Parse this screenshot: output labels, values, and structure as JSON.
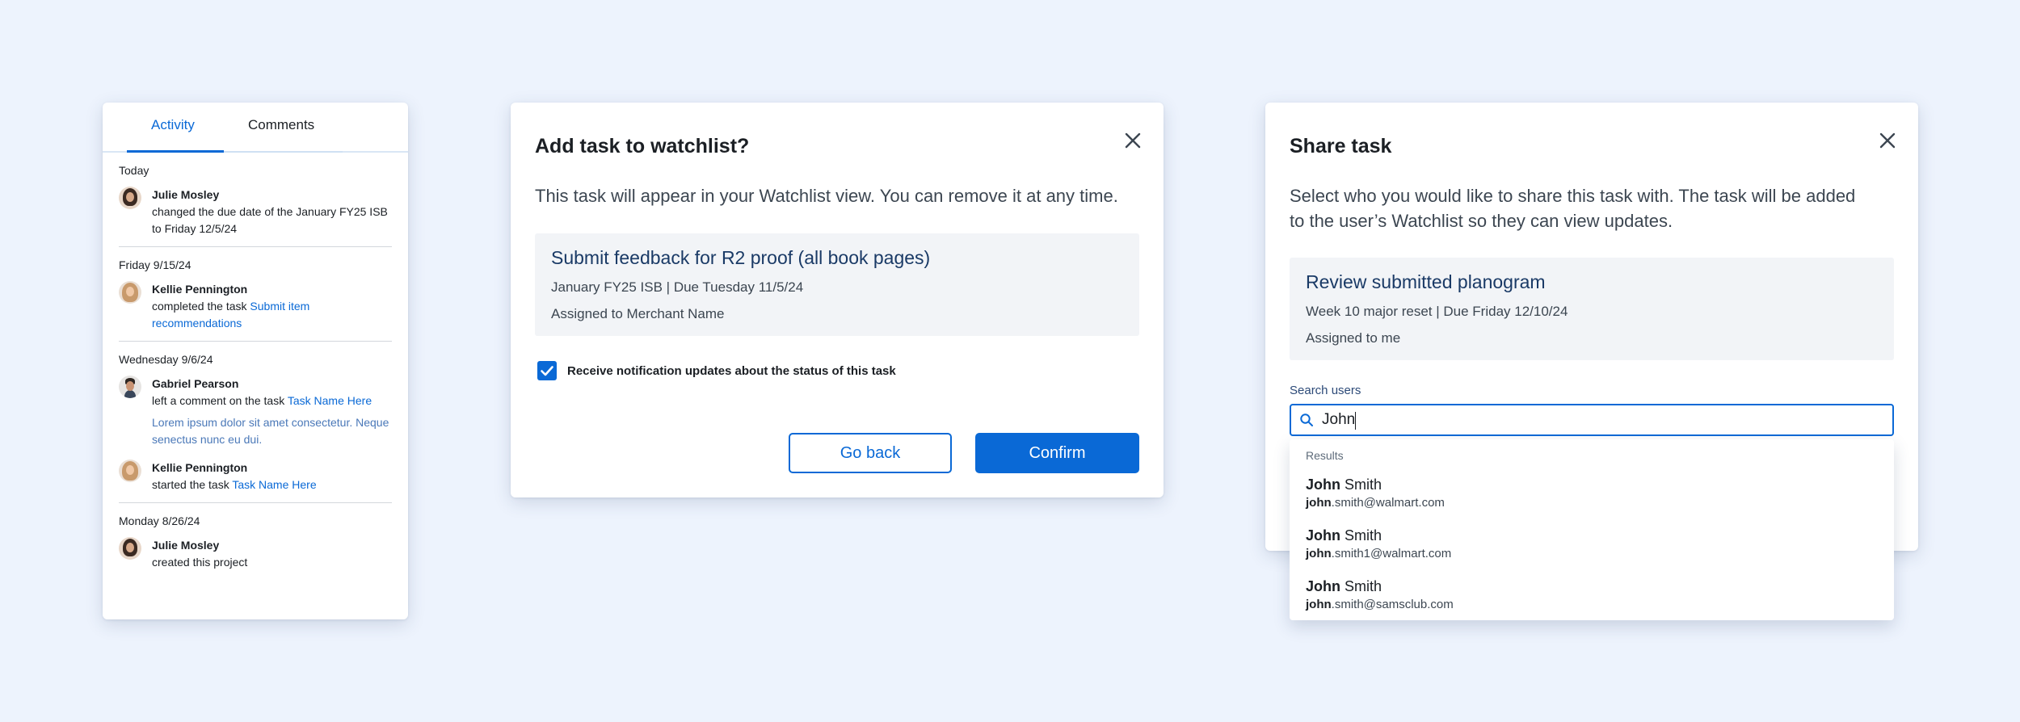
{
  "activity_panel": {
    "tabs": [
      {
        "label": "Activity"
      },
      {
        "label": "Comments"
      }
    ],
    "groups": [
      {
        "date": "Today",
        "entries": [
          {
            "name": "Julie Mosley",
            "text": "changed the due date of the January FY25 ISB to Friday 12/5/24"
          }
        ]
      },
      {
        "date": "Friday 9/15/24",
        "entries": [
          {
            "name": "Kellie Pennington",
            "text": "completed the task ",
            "link": "Submit item recommendations"
          }
        ]
      },
      {
        "date": "Wednesday 9/6/24",
        "entries": [
          {
            "name": "Gabriel Pearson",
            "text": "left a comment on the task ",
            "link": "Task Name Here",
            "comment": "Lorem ipsum dolor sit amet consectetur. Neque senectus nunc eu dui."
          },
          {
            "name": "Kellie Pennington",
            "text": "started the task ",
            "link": "Task Name Here"
          }
        ]
      },
      {
        "date": "Monday 8/26/24",
        "entries": [
          {
            "name": "Julie Mosley",
            "text": "created this project"
          }
        ]
      }
    ]
  },
  "watchlist_dialog": {
    "title": "Add task to watchlist?",
    "description": "This task will appear in your Watchlist view. You can remove it at any time.",
    "task": {
      "title": "Submit feedback for R2 proof (all book pages)",
      "meta": "January FY25 ISB  |  Due Tuesday 11/5/24",
      "assigned": "Assigned to Merchant Name"
    },
    "checkbox_label": "Receive notification updates about the status of this task",
    "checkbox_checked": true,
    "go_back_label": "Go back",
    "confirm_label": "Confirm"
  },
  "share_dialog": {
    "title": "Share task",
    "description_line1": "Select who you would like to share this task with. The task will be added",
    "description_line2": "to the user’s Watchlist so they can view updates.",
    "task": {
      "title": "Review submitted planogram",
      "meta": "Week 10 major reset  |  Due Friday 12/10/24",
      "assigned": "Assigned to me"
    },
    "search_label": "Search users",
    "search_value": "John",
    "results_label": "Results",
    "results": [
      {
        "first": "John",
        "last": " Smith",
        "email_match": "john",
        "email_rest": ".smith@walmart.com"
      },
      {
        "first": "John",
        "last": " Smith",
        "email_match": "john",
        "email_rest": ".smith1@walmart.com"
      },
      {
        "first": "John",
        "last": " Smith",
        "email_match": "john",
        "email_rest": ".smith@samsclub.com"
      }
    ]
  },
  "colors": {
    "background": "#edf3fd",
    "accent": "#0a69d6",
    "task_title": "#1a3a66"
  }
}
